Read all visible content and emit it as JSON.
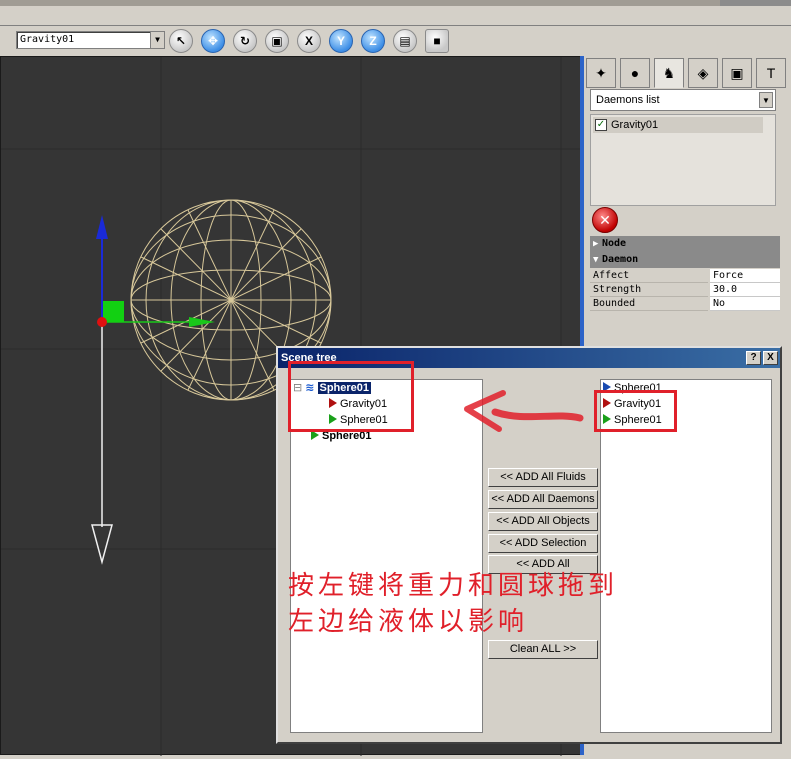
{
  "toolbar": {
    "object_select": "Gravity01",
    "buttons": [
      {
        "icon": "select-pointer-icon",
        "glyph": "↖"
      },
      {
        "icon": "move-icon",
        "glyph": "✥"
      },
      {
        "icon": "rotate-icon",
        "glyph": "↻"
      },
      {
        "icon": "scale-icon",
        "glyph": "▣"
      },
      {
        "icon": "x-axis-icon",
        "glyph": "X"
      },
      {
        "icon": "y-axis-icon",
        "glyph": "Y"
      },
      {
        "icon": "z-axis-icon",
        "glyph": "Z"
      },
      {
        "icon": "render-icon",
        "glyph": "▤"
      },
      {
        "icon": "save-icon",
        "glyph": "■"
      }
    ]
  },
  "command_panel": {
    "tabs": [
      {
        "icon": "particles-icon",
        "glyph": "✦"
      },
      {
        "icon": "sphere-icon",
        "glyph": "●"
      },
      {
        "icon": "daemon-icon",
        "glyph": "♞"
      },
      {
        "icon": "fluid-icon",
        "glyph": "◈"
      },
      {
        "icon": "render-tab-icon",
        "glyph": "▣"
      },
      {
        "icon": "tools-icon",
        "glyph": "T"
      }
    ],
    "dropdown": "Daemons list",
    "list_items": [
      "Gravity01"
    ],
    "rollouts": {
      "node": "Node",
      "daemon": "Daemon"
    },
    "properties": [
      {
        "key": "Affect",
        "value": "Force"
      },
      {
        "key": "Strength",
        "value": "30.0"
      },
      {
        "key": "Bounded",
        "value": "No"
      }
    ]
  },
  "scene_tree": {
    "title": "Scene tree",
    "help_btn": "?",
    "close_btn": "X",
    "left_tree": [
      {
        "label": "Sphere01",
        "indent": 0,
        "kind": "fluid",
        "selected": true
      },
      {
        "label": "Gravity01",
        "indent": 1,
        "kind": "daemon"
      },
      {
        "label": "Sphere01",
        "indent": 1,
        "kind": "object"
      },
      {
        "label": "Sphere01",
        "indent": 0,
        "kind": "object",
        "bold": true
      }
    ],
    "right_tree": [
      {
        "label": "Sphere01",
        "kind": "fluid"
      },
      {
        "label": "Gravity01",
        "kind": "daemon"
      },
      {
        "label": "Sphere01",
        "kind": "object"
      }
    ],
    "buttons": [
      "<< ADD All Fluids",
      "<< ADD All Daemons",
      "<< ADD All Objects",
      "<< ADD Selection",
      "<< ADD All",
      "Clean ALL >>"
    ]
  },
  "annotation": {
    "line1": "按左键将重力和圆球拖到",
    "line2": "左边给液体以影响"
  },
  "colors": {
    "viewport_bg": "#353535",
    "wire": "#d8c89a",
    "annotation_red": "#e0202a"
  }
}
